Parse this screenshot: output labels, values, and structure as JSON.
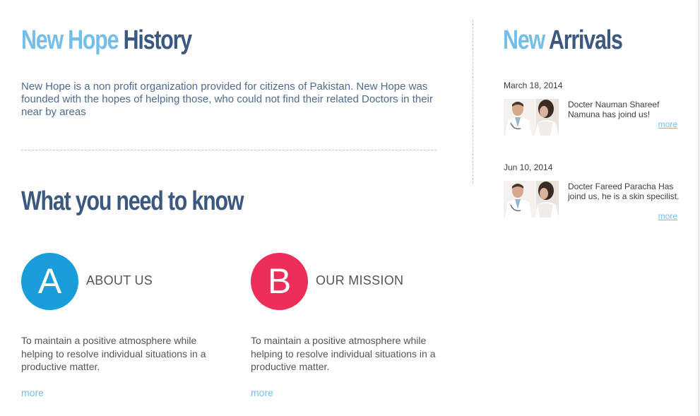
{
  "history": {
    "title_accent": "New Hope",
    "title_rest": "History",
    "text": "New Hope is a non profit organization provided for citizens of Pakistan. New Hope was founded with the hopes of helping those, who could not find their related Doctors in their near by areas"
  },
  "know": {
    "title": "What you need to know",
    "features": [
      {
        "letter": "A",
        "title": "ABOUT US",
        "text": "To maintain a positive atmosphere while helping to resolve individual situations in a productive matter.",
        "more": "more",
        "color": "#1a9ed9"
      },
      {
        "letter": "B",
        "title": "OUR MISSION",
        "text": "To maintain a positive atmosphere while helping to resolve individual situations in a productive matter.",
        "more": "more",
        "color": "#ec2e58"
      }
    ]
  },
  "arrivals": {
    "title_accent": "New",
    "title_rest": "Arrivals",
    "items": [
      {
        "date": "March 18, 2014",
        "text": "Docter Nauman Shareef Namuna has joind us!",
        "more": "more"
      },
      {
        "date": "Jun 10, 2014",
        "text": "Docter Fareed Paracha Has joind us, he is a skin specilist.",
        "more": "more"
      }
    ]
  },
  "colors": {
    "accent": "#73bfea",
    "heading_dark": "#3a5880",
    "body_text": "#506b8f"
  }
}
